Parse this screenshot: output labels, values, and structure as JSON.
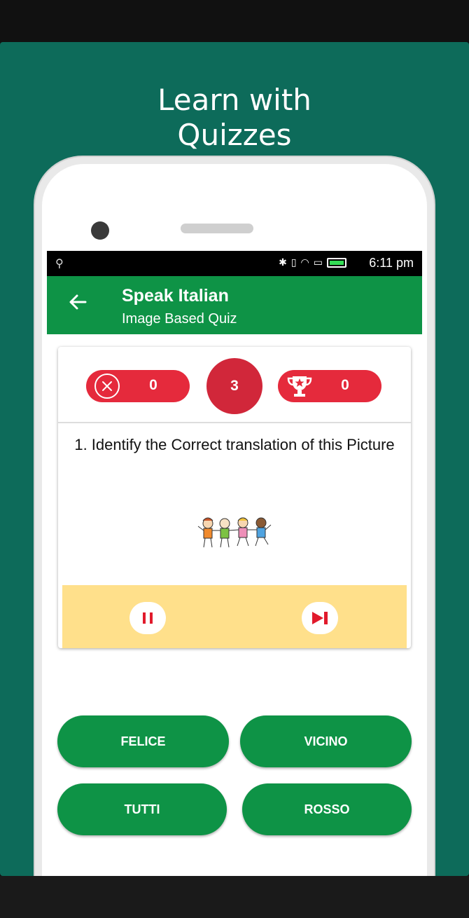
{
  "promo": {
    "headline_line1": "Learn with",
    "headline_line2": "Quizzes"
  },
  "status_bar": {
    "time": "6:11 pm"
  },
  "app_bar": {
    "title": "Speak Italian",
    "subtitle": "Image Based Quiz"
  },
  "scoreboard": {
    "wrong_count": "0",
    "question_counter": "3",
    "score": "0"
  },
  "question": {
    "text": "1. Identify the Correct translation of this Picture"
  },
  "options": [
    {
      "label": "FELICE"
    },
    {
      "label": "VICINO"
    },
    {
      "label": "TUTTI"
    },
    {
      "label": "ROSSO"
    }
  ],
  "colors": {
    "banner": "#0d6b5a",
    "app_bar": "#0e9346",
    "pill_red": "#e52a3c",
    "counter_red": "#d1273a",
    "controls_bg": "#ffe08b",
    "option_green": "#0e9346"
  },
  "icons": {
    "back": "arrow-left",
    "wrong": "circle-x",
    "score": "trophy-star",
    "pause": "pause",
    "next": "skip-next",
    "picture": "children-holding-hands"
  }
}
